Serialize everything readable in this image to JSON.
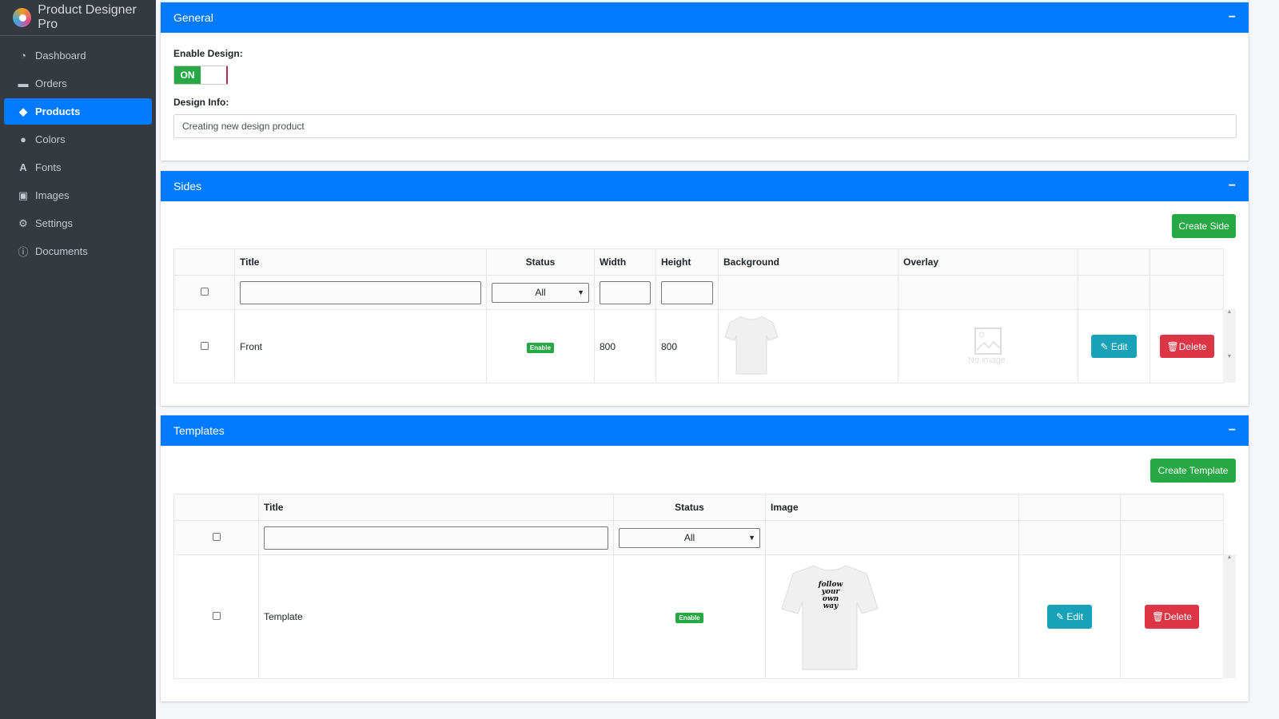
{
  "app": {
    "title": "Product Designer Pro"
  },
  "sidebar": {
    "items": [
      {
        "label": "Dashboard",
        "icon": "dashboard-icon"
      },
      {
        "label": "Orders",
        "icon": "inbox-icon"
      },
      {
        "label": "Products",
        "icon": "tag-icon",
        "active": true
      },
      {
        "label": "Colors",
        "icon": "palette-icon"
      },
      {
        "label": "Fonts",
        "icon": "font-icon"
      },
      {
        "label": "Images",
        "icon": "images-icon"
      },
      {
        "label": "Settings",
        "icon": "gear-icon"
      },
      {
        "label": "Documents",
        "icon": "info-icon"
      }
    ]
  },
  "general": {
    "title": "General",
    "minimize": "−",
    "enable_label": "Enable Design:",
    "toggle_on": "ON",
    "design_info_label": "Design Info:",
    "design_info_value": "Creating new design product"
  },
  "sides": {
    "title": "Sides",
    "minimize": "−",
    "create_button": "Create Side",
    "columns": [
      "Title",
      "Status",
      "Width",
      "Height",
      "Background",
      "Overlay"
    ],
    "filter_status": "All",
    "rows": [
      {
        "title": "Front",
        "status": "Enable",
        "width": "800",
        "height": "800",
        "overlay": "No image.",
        "edit": "Edit",
        "delete": "Delete"
      }
    ]
  },
  "templates": {
    "title": "Templates",
    "minimize": "−",
    "create_button": "Create Template",
    "columns": [
      "Title",
      "Status",
      "Image"
    ],
    "filter_status": "All",
    "rows": [
      {
        "title": "Template",
        "status": "Enable",
        "edit": "Edit",
        "delete": "Delete",
        "image_art": "follow your own way"
      }
    ]
  },
  "colors": {
    "primary": "#007bff",
    "success": "#28a745",
    "info": "#17a2b8",
    "danger": "#dc3545",
    "sidebar": "#343a40"
  }
}
